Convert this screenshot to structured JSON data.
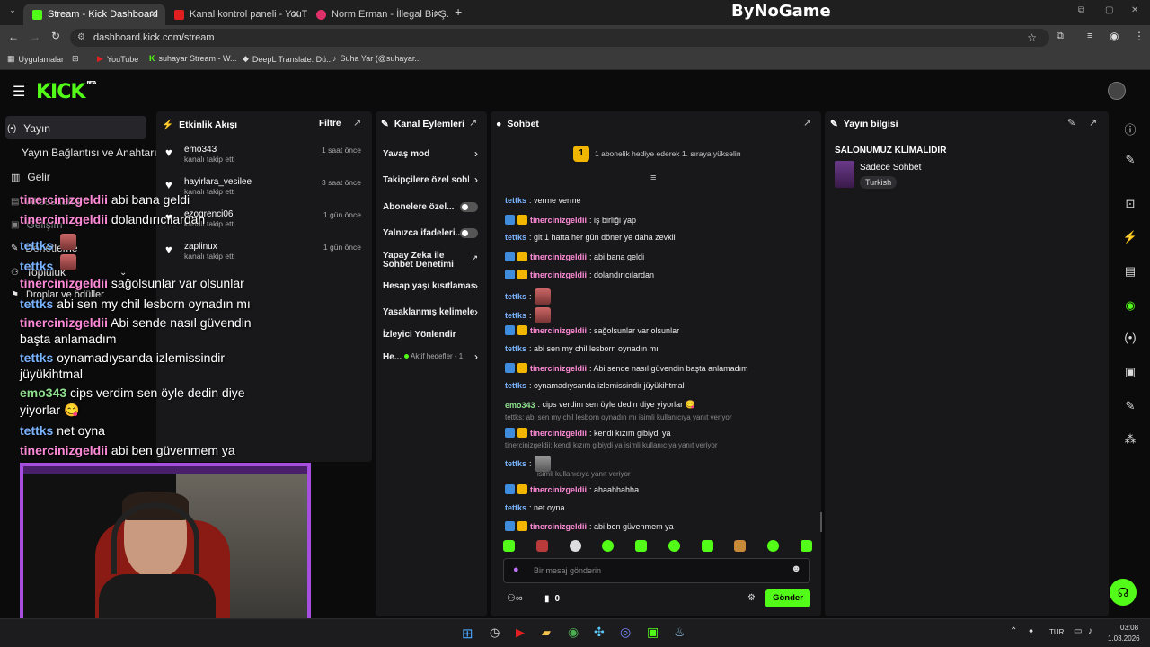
{
  "browser": {
    "tabs": [
      {
        "title": "Stream - Kick Dashboard",
        "active": true
      },
      {
        "title": "Kanal kontrol paneli - YouTube",
        "active": false
      },
      {
        "title": "Norm Erman - İllegal Bir Ş...",
        "active": false
      }
    ],
    "url": "dashboard.kick.com/stream",
    "watermark": "ByNoGame",
    "bookmarks": [
      "Uygulamalar",
      "YouTube",
      "suhayar Stream - W...",
      "DeepL Translate: Dü...",
      "Suha Yar (@suhayar..."
    ]
  },
  "app": {
    "logo": "KICK",
    "logo_badge": "BETA"
  },
  "sidebar": {
    "items": [
      {
        "label": "Yayın"
      },
      {
        "label": "Yayın Bağlantısı ve Anahtarı"
      },
      {
        "label": "Gelir"
      },
      {
        "label": "Aksesuarlar"
      },
      {
        "label": "Gelişim"
      },
      {
        "label": "Denetleme"
      },
      {
        "label": "Topluluk"
      },
      {
        "label": "Droplar ve ödüller"
      }
    ]
  },
  "activity": {
    "title": "Etkinlik Akışı",
    "filter": "Filtre",
    "events": [
      {
        "name": "emo343",
        "sub": "kanalı takip etti",
        "time": "1 saat önce"
      },
      {
        "name": "hayirlara_vesilee",
        "sub": "kanalı takip etti",
        "time": "3 saat önce"
      },
      {
        "name": "ezogrenci06",
        "sub": "kanalı takip etti",
        "time": "1 gün önce"
      },
      {
        "name": "zaplinux",
        "sub": "kanalı takip etti",
        "time": "1 gün önce"
      }
    ]
  },
  "actions": {
    "title": "Kanal Eylemleri",
    "items": [
      {
        "label": "Yavaş mod"
      },
      {
        "label": "Takipçilere özel sohbet"
      },
      {
        "label": "Abonelere özel..."
      },
      {
        "label": "Yalnızca ifadeleri..."
      },
      {
        "label": "Yapay Zeka ile"
      },
      {
        "label": "Sohbet Denetimi"
      },
      {
        "label": "Hesap yaşı kısıtlamas"
      },
      {
        "label": "Yasaklanmış kelimele"
      },
      {
        "label": "İzleyici Yönlendir"
      },
      {
        "label": "He..."
      },
      {
        "label": "Aktif hedefler - 1"
      }
    ]
  },
  "chat": {
    "title": "Sohbet",
    "sub_promo_count": "1",
    "sub_promo": "1 abonelik hediye ederek 1. sıraya yükselin",
    "messages": [
      {
        "user": "tettks",
        "text": ": verme verme"
      },
      {
        "user": "tinercinizgeldii",
        "text": ": iş birliği yap"
      },
      {
        "user": "tettks",
        "text": ": git 1 hafta her gün döner ye daha zevkli"
      },
      {
        "user": "tinercinizgeldii",
        "text": ": abi bana geldi"
      },
      {
        "user": "tinercinizgeldii",
        "text": ": dolandırıcılardan"
      },
      {
        "user": "tettks",
        "text": ":"
      },
      {
        "user": "tettks",
        "text": ":"
      },
      {
        "user": "tinercinizgeldii",
        "text": ": sağolsunlar var olsunlar"
      },
      {
        "user": "tettks",
        "text": ": abi sen my chil lesborn oynadın mı"
      },
      {
        "user": "tinercinizgeldii",
        "text": ": Abi sende nasıl güvendin başta anlamadım"
      },
      {
        "user": "tettks",
        "text": ": oynamadıysanda izlemissindir jüyükihtmal"
      },
      {
        "user": "emo343",
        "text": ": cips verdim sen öyle dedin diye yiyorlar 😋"
      },
      {
        "user": "tinercinizgeldii",
        "text": ": kendi kızım gibiydi ya"
      },
      {
        "user": "tettks",
        "text": ":"
      },
      {
        "user": "tinercinizgeldii",
        "text": ": ahaahhahha"
      },
      {
        "user": "tettks",
        "text": ": net oyna"
      },
      {
        "user": "tinercinizgeldii",
        "text": ": abi ben güvenmem ya"
      }
    ],
    "replies": [
      "tettks: abi sen my chil lesborn oynadın mı isimli kullanıcıya yanıt veriyor",
      "tinercinizgeldii: kendi kızım gibiydi ya isimli kullanıcıya yanıt veriyor",
      "isimli kullanıcıya yanıt veriyor"
    ],
    "input_placeholder": "Bir mesaj gönderin",
    "points": "0",
    "send": "Gönder"
  },
  "stream_info": {
    "title": "Yayın bilgisi",
    "stream_title": "SALONUMUZ KLİMALIDIR",
    "category": "Sadece Sohbet",
    "language": "Turkish"
  },
  "overlay": {
    "lines": [
      {
        "user": "tinercinizgeldii",
        "text": "abi bana geldi"
      },
      {
        "user": "tinercinizgeldii",
        "text": "dolandırıcılardan"
      },
      {
        "user": "tettks",
        "text": ""
      },
      {
        "user": "tettks",
        "text": ""
      },
      {
        "user": "tinercinizgeldii",
        "text": "sağolsunlar var olsunlar"
      },
      {
        "user": "tettks",
        "text": "abi sen my chil lesborn oynadın mı"
      },
      {
        "user": "tinercinizgeldii",
        "text": "Abi sende nasıl güvendin"
      },
      {
        "user": "",
        "text": "başta anlamadım"
      },
      {
        "user": "tettks",
        "text": "oynamadıysanda izlemissindir"
      },
      {
        "user": "",
        "text": "jüyükihtmal"
      },
      {
        "user": "emo343",
        "text": "cips verdim sen öyle dedin diye"
      },
      {
        "user": "",
        "text": "yiyorlar 😋"
      },
      {
        "user": "tettks",
        "text": "net oyna"
      },
      {
        "user": "tinercinizgeldii",
        "text": "abi ben güvenmem ya"
      }
    ]
  },
  "taskbar": {
    "lang": "TUR",
    "time": "03:08",
    "date": "1.03.2026"
  },
  "colors": {
    "accent": "#53fc18",
    "panel": "#18181a",
    "cam_border": "#a64ee0"
  }
}
